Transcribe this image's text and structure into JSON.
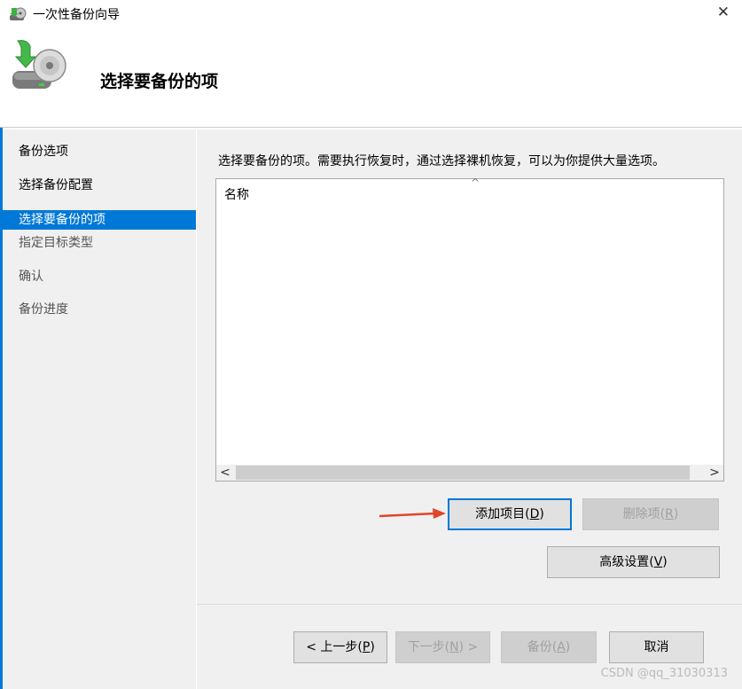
{
  "window": {
    "title": "一次性备份向导",
    "close_glyph": "✕"
  },
  "header": {
    "title": "选择要备份的项"
  },
  "sidebar": {
    "items": [
      {
        "label": "备份选项"
      },
      {
        "label": "选择备份配置"
      },
      {
        "label": "选择要备份的项",
        "active": true
      },
      {
        "label": "指定目标类型"
      },
      {
        "label": "确认"
      },
      {
        "label": "备份进度"
      }
    ]
  },
  "main": {
    "intro": "选择要备份的项。需要执行恢复时，通过选择裸机恢复，可以为你提供大量选项。",
    "list": {
      "column_header": "名称",
      "sort_indicator": "^",
      "scroll_left": "<",
      "scroll_right": ">"
    },
    "buttons": {
      "add_items": {
        "text": "添加项目(",
        "key": "D",
        "close": ")"
      },
      "remove_item": {
        "text": "删除项(",
        "key": "R",
        "close": ")"
      },
      "advanced": {
        "text": "高级设置(",
        "key": "V",
        "close": ")"
      }
    }
  },
  "footer": {
    "prev": {
      "text": "< 上一步(",
      "key": "P",
      "close": ")"
    },
    "next": {
      "text": "下一步(",
      "key": "N",
      "close": ") >"
    },
    "backup": {
      "text": "备份(",
      "key": "A",
      "close": ")"
    },
    "cancel": {
      "text": "取消"
    }
  },
  "watermark": "CSDN @qq_31030313",
  "colors": {
    "accent": "#0078d7",
    "annotation_arrow": "#e0452b"
  }
}
